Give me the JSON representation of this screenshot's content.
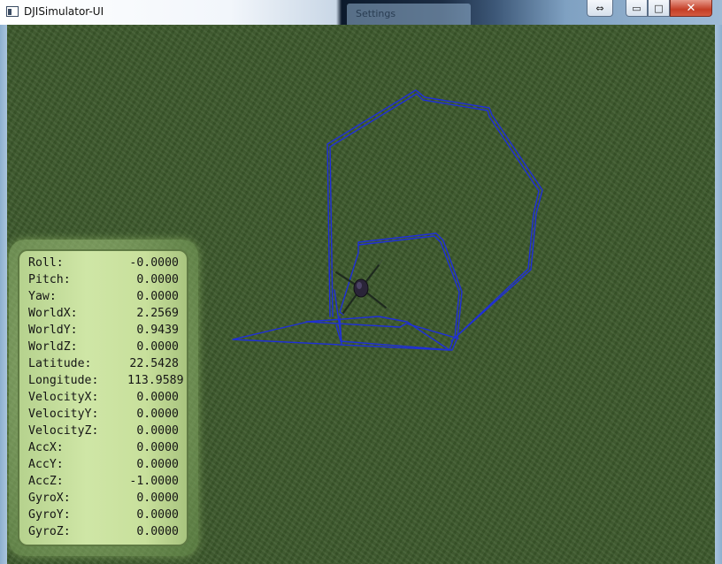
{
  "window": {
    "title": "DJISimulator-UI",
    "background_tab": "Settings",
    "controls": {
      "move": "⇔",
      "minimize": "▭",
      "maximize": "□",
      "close": "✕"
    }
  },
  "telemetry": [
    {
      "label": "Roll:",
      "value": "-0.0000"
    },
    {
      "label": "Pitch:",
      "value": "0.0000"
    },
    {
      "label": "Yaw:",
      "value": "0.0000"
    },
    {
      "label": "WorldX:",
      "value": "2.2569"
    },
    {
      "label": "WorldY:",
      "value": "0.9439"
    },
    {
      "label": "WorldZ:",
      "value": "0.0000"
    },
    {
      "label": "Latitude:",
      "value": "22.5428"
    },
    {
      "label": "Longitude:",
      "value": "113.9589"
    },
    {
      "label": "VelocityX:",
      "value": "0.0000"
    },
    {
      "label": "VelocityY:",
      "value": "0.0000"
    },
    {
      "label": "VelocityZ:",
      "value": "0.0000"
    },
    {
      "label": "AccX:",
      "value": "0.0000"
    },
    {
      "label": "AccY:",
      "value": "0.0000"
    },
    {
      "label": "AccZ:",
      "value": "-1.0000"
    },
    {
      "label": "GyroX:",
      "value": "0.0000"
    },
    {
      "label": "GyroY:",
      "value": "0.0000"
    },
    {
      "label": "GyroZ:",
      "value": "0.0000"
    }
  ],
  "colors": {
    "flight_path": "#1f2fd8",
    "ground": "#3d5a2c",
    "panel": "#cfe6a6"
  },
  "icons": {
    "app": "app-window-icon",
    "drone": "quadcopter-icon"
  }
}
